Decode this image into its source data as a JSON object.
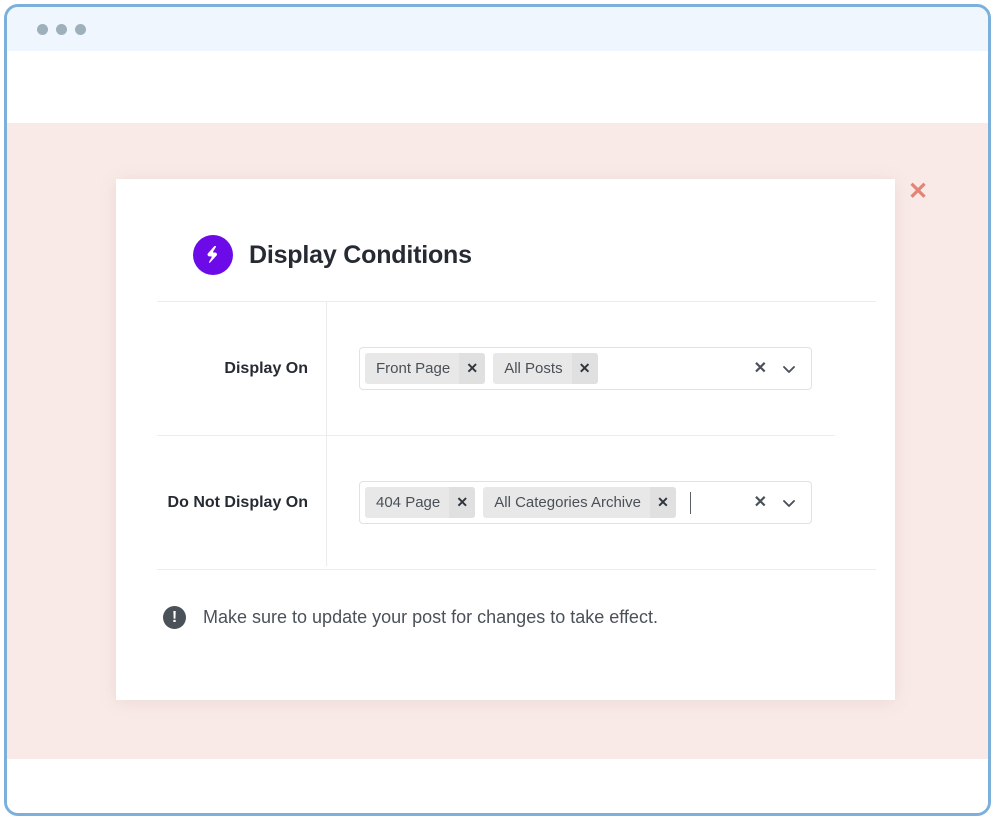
{
  "window": {
    "traffic_light_count": 3,
    "border_color": "#7cb0db",
    "titlebar_color": "#eff6fd",
    "stage_color": "#f9eae8"
  },
  "modal": {
    "close_label": "✕",
    "close_color": "#e08070",
    "brand_icon": "lightning-bolt-icon",
    "brand_color": "#6c0ae8",
    "title": "Display Conditions",
    "rows": [
      {
        "label": "Display On",
        "tags": [
          {
            "label": "Front Page",
            "remove": "✕"
          },
          {
            "label": "All Posts",
            "remove": "✕"
          }
        ],
        "show_caret": false,
        "clear_label": "✕",
        "chevron": "chevron-down-icon"
      },
      {
        "label": "Do Not Display On",
        "tags": [
          {
            "label": "404 Page",
            "remove": "✕"
          },
          {
            "label": "All Categories Archive",
            "remove": "✕"
          }
        ],
        "show_caret": true,
        "clear_label": "✕",
        "chevron": "chevron-down-icon"
      }
    ],
    "notice": {
      "icon": "exclamation-circle-icon",
      "icon_glyph": "!",
      "text": "Make sure to update your post for changes to take effect."
    }
  }
}
